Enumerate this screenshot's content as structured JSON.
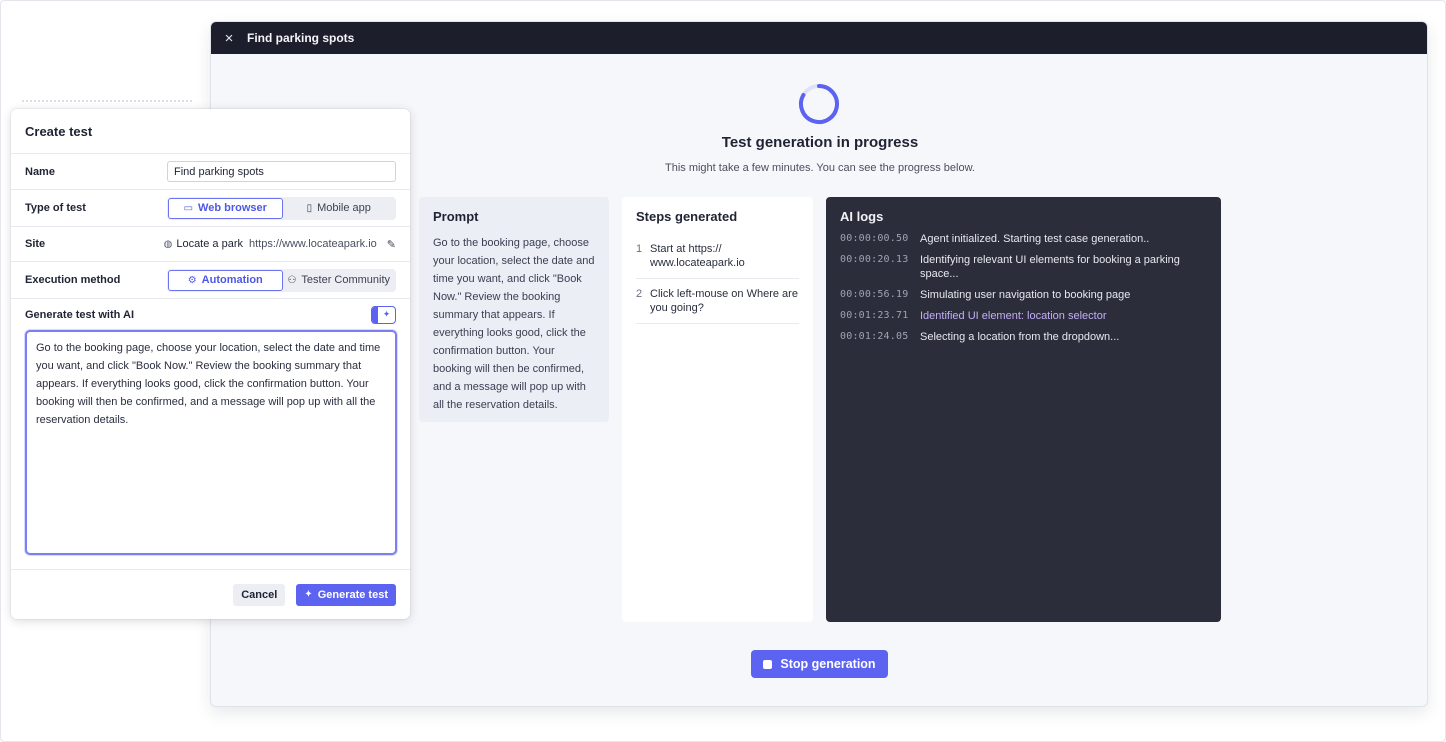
{
  "window": {
    "title": "Find parking spots",
    "close_icon": "×"
  },
  "progress": {
    "title": "Test generation in progress",
    "subtitle": "This might take a few minutes. You can see the progress below."
  },
  "prompt_panel": {
    "heading": "Prompt",
    "text": "Go to the booking page, choose your location, select the date and time you want, and click \"Book Now.\" Review the booking summary that appears. If everything looks good, click the confirmation button. Your booking will then be confirmed, and a message will pop up with all the reservation details."
  },
  "steps_panel": {
    "heading": "Steps generated",
    "steps": [
      {
        "num": "1",
        "text": "Start at https:// www.locateapark.io"
      },
      {
        "num": "2",
        "text": "Click left-mouse on Where are you going?"
      }
    ]
  },
  "logs_panel": {
    "heading": "AI logs",
    "logs": [
      {
        "ts": "00:00:00.50",
        "msg": "Agent initialized. Starting test case generation.."
      },
      {
        "ts": "00:00:20.13",
        "msg": "Identifying relevant UI elements for booking a parking space..."
      },
      {
        "ts": "00:00:56.19",
        "msg": "Simulating user navigation to booking page"
      },
      {
        "ts": "00:01:23.71",
        "msg": "Identified UI element: location selector"
      },
      {
        "ts": "00:01:24.05",
        "msg": "Selecting a location from the dropdown..."
      }
    ]
  },
  "stop_button": {
    "label": "Stop generation"
  },
  "dialog": {
    "title": "Create test",
    "name_label": "Name",
    "name_value": "Find parking spots",
    "type_label": "Type of test",
    "type_options": [
      "Web browser",
      "Mobile app"
    ],
    "site_label": "Site",
    "site_name": "Locate a park",
    "site_url": "https://www.locateapark.io",
    "exec_label": "Execution method",
    "exec_options": [
      "Automation",
      "Tester Community"
    ],
    "ai_label": "Generate test with AI",
    "ai_text": "Go to the booking page, choose your location, select the date and time you want, and click \"Book Now.\" Review the booking summary that appears. If everything looks good, click the confirmation button. Your booking will then be confirmed, and a message will pop up with all the reservation details.",
    "cancel_label": "Cancel",
    "generate_label": "Generate test"
  },
  "colors": {
    "accent": "#5b63f0",
    "titlebar": "#1c1e2b",
    "logs_bg": "#2b2d3b",
    "log_highlight": "#c4aef7"
  },
  "icons": {
    "close": "close-icon",
    "spinner": "spinner-icon",
    "browser": "browser-window-icon",
    "mobile": "mobile-phone-icon",
    "globe": "globe-icon",
    "pencil": "pencil-icon",
    "robot": "robot-icon",
    "people": "people-icon",
    "sparkle": "sparkle-icon",
    "stop": "stop-square-icon"
  }
}
